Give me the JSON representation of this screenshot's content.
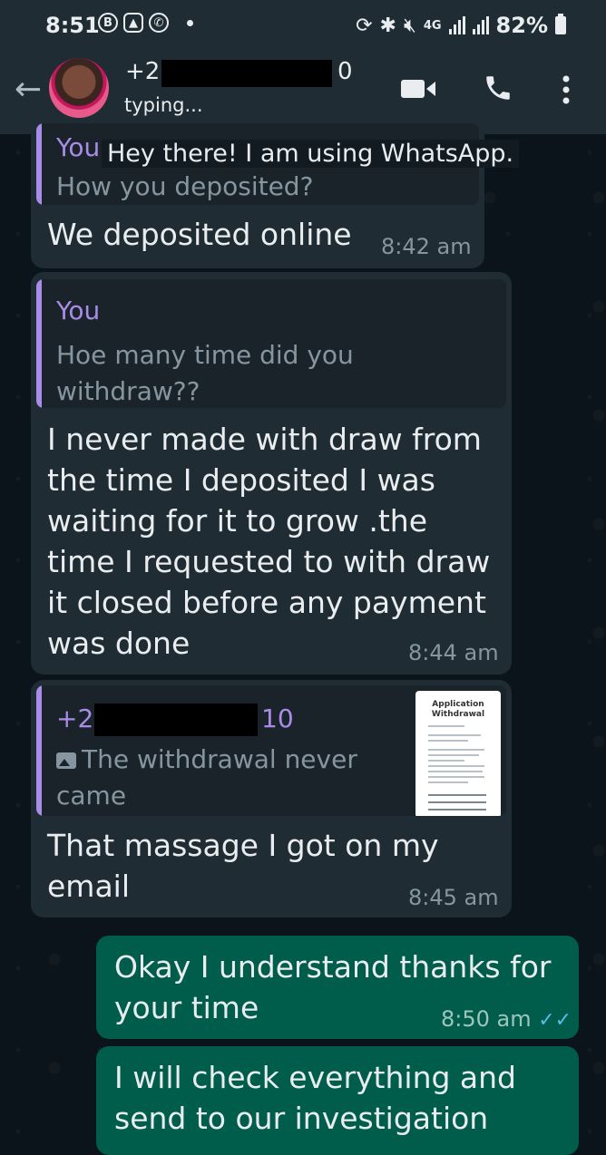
{
  "status_bar": {
    "time": "8:51",
    "network": "4G",
    "battery": "82%"
  },
  "header": {
    "contact_prefix": "+2",
    "contact_suffix": "0",
    "status": "typing..."
  },
  "about_text": "Hey there! I am using WhatsApp.",
  "messages": [
    {
      "quote_author": "You",
      "quote_text": "How you deposited?",
      "text": "We deposited online",
      "time": "8:42 am"
    },
    {
      "quote_author": "You",
      "quote_text": "Hoe many time did you withdraw??",
      "text": "I never made with draw from the time I deposited I was waiting for it to grow .the time I requested to with draw it closed before any payment was done",
      "time": "8:44 am"
    },
    {
      "quote_author_prefix": "+2",
      "quote_author_suffix": "10",
      "quote_text": "The withdrawal never came",
      "thumbnail_title": "Application Withdrawal",
      "text": "That massage I got on my email",
      "time": "8:45 am"
    },
    {
      "text": "Okay I understand thanks for your time",
      "time": "8:50 am"
    },
    {
      "text": "I will check everything and send to our investigation"
    }
  ],
  "colors": {
    "incoming_bubble": "#202c33",
    "outgoing_bubble": "#005c4b",
    "quote_accent": "#a98be8",
    "read_ticks": "#53bdeb"
  }
}
